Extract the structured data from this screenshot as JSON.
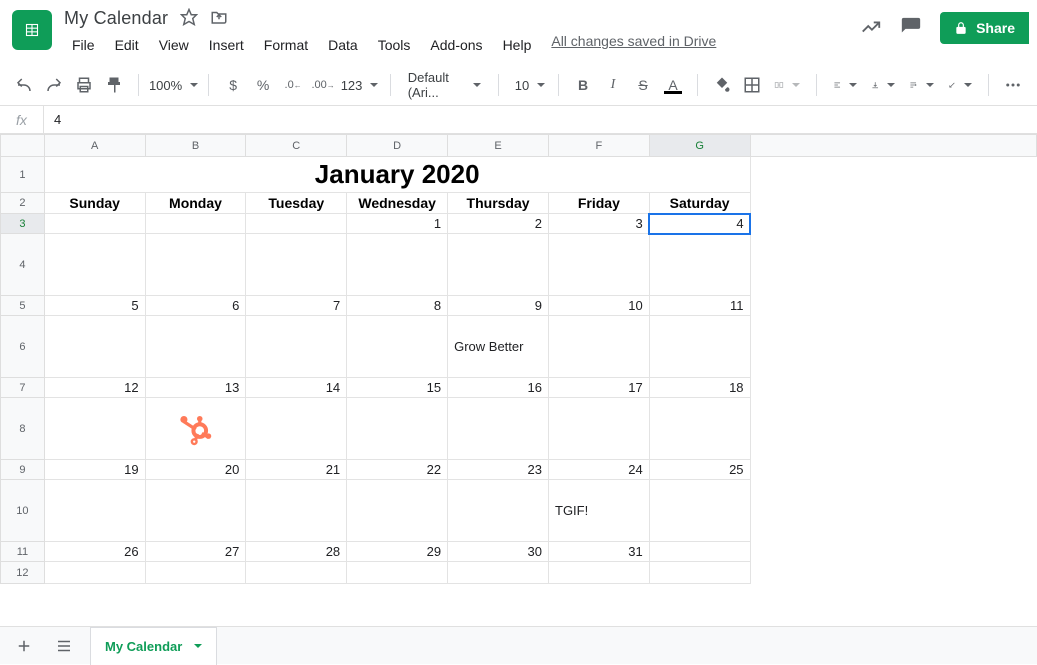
{
  "doc_title": "My Calendar",
  "menus": [
    "File",
    "Edit",
    "View",
    "Insert",
    "Format",
    "Data",
    "Tools",
    "Add-ons",
    "Help"
  ],
  "saved_text": "All changes saved in Drive",
  "share_label": "Share",
  "toolbar": {
    "zoom": "100%",
    "font": "Default (Ari...",
    "font_size": "10",
    "currency": "$",
    "percent": "%",
    "dec_dec": ".0",
    "dec_inc": ".00",
    "numfmt": "123",
    "bold": "B",
    "italic": "I"
  },
  "formula_value": "4",
  "columns": [
    "A",
    "B",
    "C",
    "D",
    "E",
    "F",
    "G"
  ],
  "selected_col": "G",
  "rows": [
    "1",
    "2",
    "3",
    "4",
    "5",
    "6",
    "7",
    "8",
    "9",
    "10",
    "11",
    "12"
  ],
  "selected_row": "3",
  "calendar_title": "January 2020",
  "day_headers": [
    "Sunday",
    "Monday",
    "Tuesday",
    "Wednesday",
    "Thursday",
    "Friday",
    "Saturday"
  ],
  "weeks": [
    {
      "nums": [
        "",
        "",
        "1",
        "2",
        "3",
        "4"
      ],
      "sunday": "",
      "notes": [
        "",
        "",
        "",
        "",
        "",
        "",
        ""
      ]
    },
    {
      "nums": [
        "6",
        "7",
        "8",
        "9",
        "10",
        "11"
      ],
      "sunday": "5",
      "notes": [
        "",
        "",
        "",
        "",
        "Grow Better",
        "",
        ""
      ]
    },
    {
      "nums": [
        "13",
        "14",
        "15",
        "16",
        "17",
        "18"
      ],
      "sunday": "12",
      "notes": [
        "",
        "hub",
        "",
        "",
        "",
        "",
        ""
      ]
    },
    {
      "nums": [
        "20",
        "21",
        "22",
        "23",
        "24",
        "25"
      ],
      "sunday": "19",
      "notes": [
        "",
        "",
        "",
        "",
        "",
        "TGIF!",
        ""
      ]
    },
    {
      "nums": [
        "27",
        "28",
        "29",
        "30",
        "31",
        ""
      ],
      "sunday": "26",
      "notes": [
        "",
        "",
        "",
        "",
        "",
        "",
        ""
      ]
    }
  ],
  "sheet_tab": "My Calendar"
}
